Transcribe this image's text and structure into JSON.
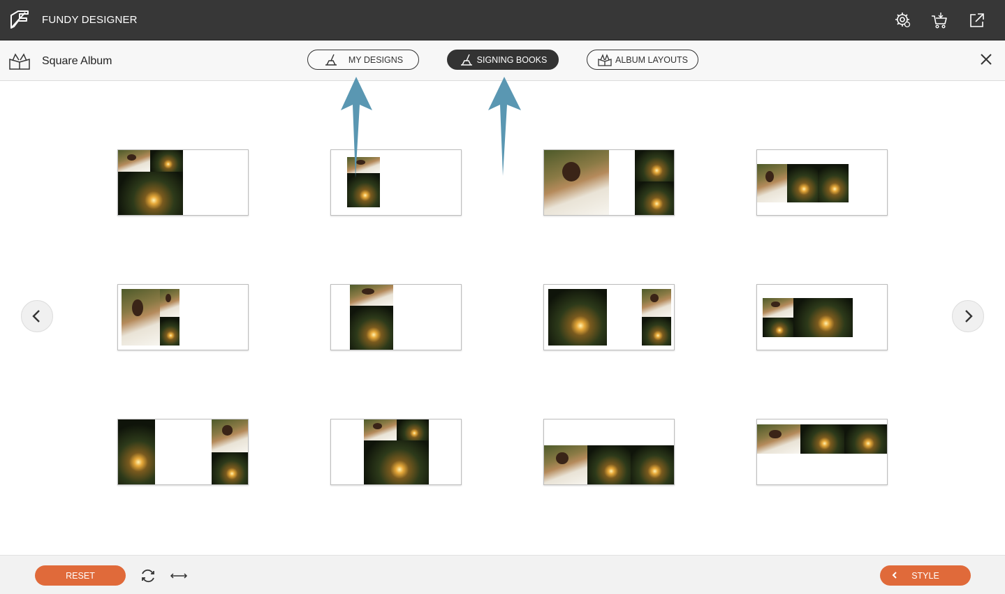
{
  "app": {
    "title": "FUNDY DESIGNER"
  },
  "header": {
    "icons": [
      "settings-gear-icon",
      "cart-icon",
      "external-link-icon"
    ]
  },
  "subbar": {
    "album_title": "Square Album",
    "tabs": [
      {
        "label": "MY DESIGNS",
        "active": false
      },
      {
        "label": "SIGNING BOOKS",
        "active": true
      },
      {
        "label": "ALBUM LAYOUTS",
        "active": false
      }
    ]
  },
  "footer": {
    "reset_label": "RESET",
    "style_label": "STYLE"
  },
  "colors": {
    "topbar": "#373737",
    "accent": "#e06a3a",
    "arrow": "#5a97b2"
  }
}
